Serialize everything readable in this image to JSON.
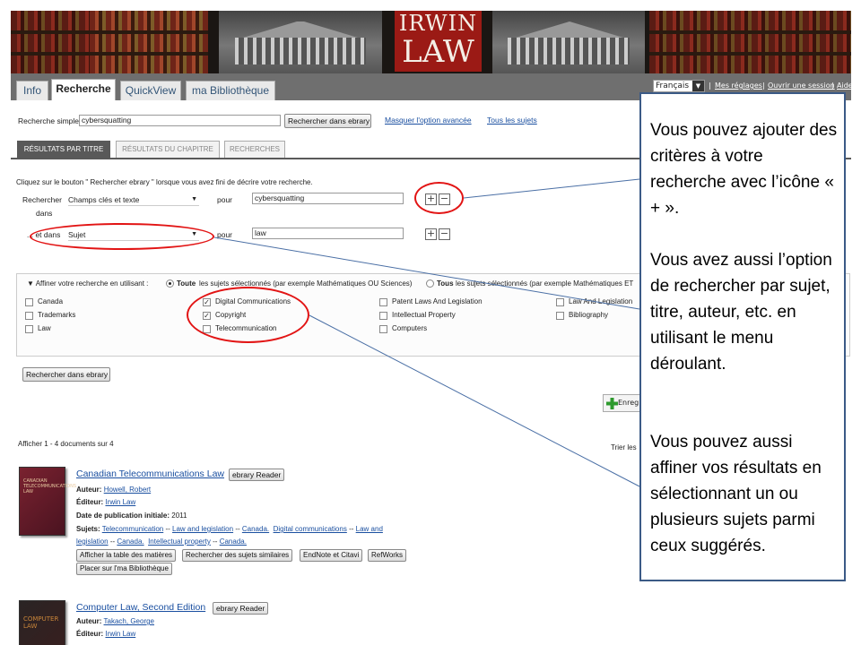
{
  "banner": {
    "logo_line1": "IRWIN",
    "logo_line2": "LAW"
  },
  "nav": {
    "tabs": [
      {
        "label": "Info",
        "active": false
      },
      {
        "label": "Recherche",
        "active": true
      },
      {
        "label": "QuickView",
        "active": false
      },
      {
        "label": "ma Bibliothèque",
        "active": false
      }
    ],
    "language": "Français",
    "links": [
      "Mes réglages",
      "Ouvrir une session",
      "Aide"
    ]
  },
  "search": {
    "simple_label": "Recherche simple:",
    "simple_value": "cybersquatting",
    "search_button": "Rechercher dans ebrary",
    "link_hide_advanced": "Masquer l'option avancée",
    "link_all_subjects": "Tous les sujets"
  },
  "subtabs": [
    "Résultats par titre",
    "Résultats du chapitre",
    "Recherches"
  ],
  "advanced": {
    "instruction": "Cliquez sur le bouton \" Rechercher ebrary \" lorsque vous avez fini de décrire votre recherche.",
    "row1": {
      "label": "Rechercher",
      "label2": "dans",
      "field": "Champs clés et texte",
      "pour": "pour",
      "value": "cybersquatting"
    },
    "row2": {
      "label": "... et dans",
      "field": "Sujet",
      "pour": "pour",
      "value": "law"
    }
  },
  "refine": {
    "prefix": "▼ Affiner votre recherche en utilisant :",
    "opt_toute_bold": "Toute",
    "opt_toute_rest": "les sujets sélectionnés (par exemple Mathématiques OU Sciences)",
    "opt_tous_bold": "Tous",
    "opt_tous_rest": "les sujets sélectionnés (par exemple Mathématiques ET",
    "columns": [
      [
        {
          "label": "Canada",
          "checked": false
        },
        {
          "label": "Trademarks",
          "checked": false
        },
        {
          "label": "Law",
          "checked": false
        }
      ],
      [
        {
          "label": "Digital Communications",
          "checked": true
        },
        {
          "label": "Copyright",
          "checked": true
        },
        {
          "label": "Telecommunication",
          "checked": false
        }
      ],
      [
        {
          "label": "Patent Laws And Legislation",
          "checked": false
        },
        {
          "label": "Intellectual Property",
          "checked": false
        },
        {
          "label": "Computers",
          "checked": false
        }
      ],
      [
        {
          "label": "Law And Legislation",
          "checked": false
        },
        {
          "label": "Bibliography",
          "checked": false
        }
      ]
    ],
    "search_button": "Rechercher dans ebrary"
  },
  "results": {
    "save_button": "Enreg",
    "count": "Afficher 1 - 4 documents sur 4",
    "sort_label": "Trier les",
    "items": [
      {
        "title": "Canadian Telecommunications Law",
        "reader": "ebrary Reader",
        "author_label": "Auteur:",
        "author": "Howell, Robert",
        "publisher_label": "Éditeur:",
        "publisher": "Irwin Law",
        "date_label": "Date de publication initiale:",
        "date": "2011",
        "subjects_label": "Sujets:",
        "subjects_line1": [
          "Telecommunication",
          "--",
          "Law and legislation",
          "--",
          "Canada.",
          "Digital communications",
          "--",
          "Law and"
        ],
        "subjects_line2": [
          "legislation",
          "--",
          "Canada.",
          "Intellectual property",
          "--",
          "Canada."
        ],
        "buttons": [
          "Afficher la table des matières",
          "Rechercher des sujets similaires",
          "EndNote et Citavi",
          "RefWorks"
        ],
        "button2": "Placer sur l'ma Bibliothèque",
        "cover_text": "CANADIAN TELECOMMUNICATIONS LAW"
      },
      {
        "title": "Computer Law, Second Edition",
        "reader": "ebrary Reader",
        "author_label": "Auteur:",
        "author": "Takach, George",
        "publisher_label": "Éditeur:",
        "publisher": "Irwin Law",
        "cover_text": "COMPUTER LAW"
      }
    ]
  },
  "callout": {
    "p1": "Vous pouvez ajouter des critères à votre recherche avec l’icône « + ».",
    "p2": "Vous avez aussi l’option de rechercher par sujet, titre, auteur, etc. en utilisant le menu déroulant.",
    "p3": "Vous pouvez aussi affiner vos résultats en sélectionnant un ou plusieurs sujets parmi ceux suggérés."
  },
  "colors": {
    "annotation_red": "#e21414",
    "callout_border": "#3b5a86",
    "link_blue": "#1a4fa0",
    "logo_red": "#9b1a15"
  }
}
